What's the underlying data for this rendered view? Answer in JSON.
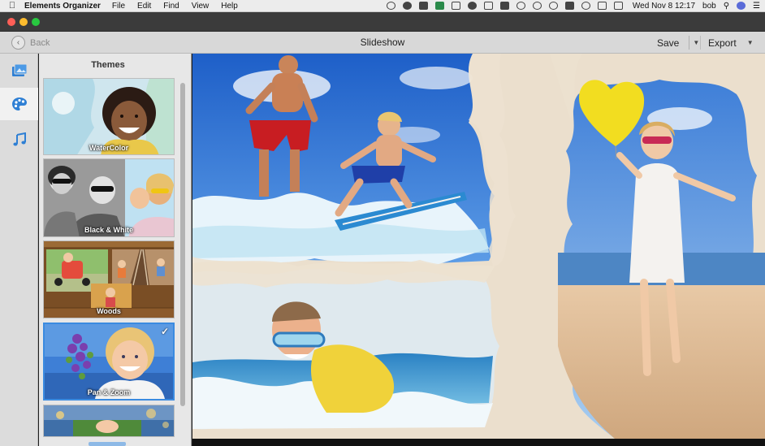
{
  "menubar": {
    "app_name": "Elements Organizer",
    "menus": [
      "File",
      "Edit",
      "Find",
      "View",
      "Help"
    ],
    "status_icons": [
      "adobe-cc-icon",
      "creative-cloud-icon",
      "dropbox-icon",
      "app-status-icon",
      "google-drive-icon",
      "cloud-icon",
      "display-icon",
      "clipboard-icon",
      "shield-icon",
      "magnifier-status-icon",
      "time-machine-icon",
      "bluetooth-icon",
      "wifi-icon",
      "airplay-icon",
      "battery-icon"
    ],
    "clock": "Wed Nov 8  12:17",
    "user": "bob"
  },
  "toolbar": {
    "back_label": "Back",
    "title": "Slideshow",
    "save_label": "Save",
    "export_label": "Export"
  },
  "sidebar_icons": [
    "media-icon",
    "themes-palette-icon",
    "music-icon"
  ],
  "themes": {
    "title": "Themes",
    "items": [
      {
        "label": "WaterColor",
        "selected": false
      },
      {
        "label": "Black & White",
        "selected": false
      },
      {
        "label": "Woods",
        "selected": false
      },
      {
        "label": "Pan & Zoom",
        "selected": true
      },
      {
        "label": "",
        "selected": false
      }
    ]
  },
  "colors": {
    "accent": "#3b8be0",
    "sky": "#2f6fd0",
    "paper": "#ede2d0",
    "wave": "#e8f4fb",
    "balloon": "#f2dd20"
  }
}
